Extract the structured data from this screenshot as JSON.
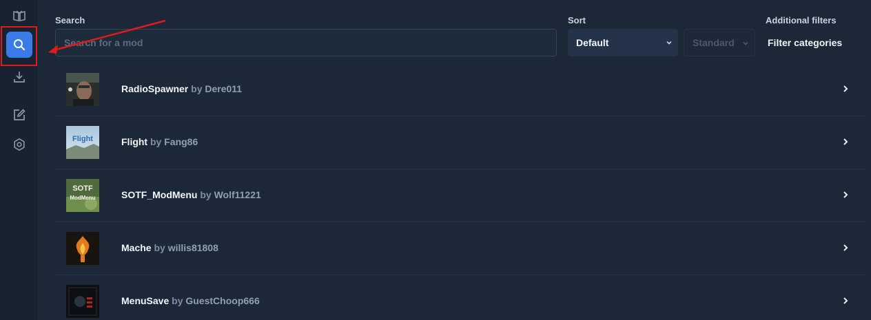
{
  "search": {
    "label": "Search",
    "placeholder": "Search for a mod"
  },
  "sort": {
    "label": "Sort",
    "selected": "Default",
    "secondary": "Standard"
  },
  "filters": {
    "label": "Additional filters",
    "button": "Filter categories"
  },
  "sidebar": {
    "items": [
      {
        "name": "library",
        "icon": "book-icon"
      },
      {
        "name": "search",
        "icon": "search-icon",
        "active": true
      },
      {
        "name": "downloads",
        "icon": "download-icon"
      },
      {
        "name": "edit",
        "icon": "edit-icon"
      },
      {
        "name": "settings",
        "icon": "gear-icon"
      }
    ]
  },
  "mods": [
    {
      "name": "RadioSpawner",
      "by": "by",
      "author": "Dere011"
    },
    {
      "name": "Flight",
      "by": "by",
      "author": "Fang86",
      "thumb_text": "Flight"
    },
    {
      "name": "SOTF_ModMenu",
      "by": "by",
      "author": "Wolf11221",
      "thumb_text": "SOTF",
      "thumb_text2": "ModMenu"
    },
    {
      "name": "Mache",
      "by": "by",
      "author": "willis81808"
    },
    {
      "name": "MenuSave",
      "by": "by",
      "author": "GuestChoop666"
    }
  ],
  "colors": {
    "background": "#1c2838",
    "sidebar": "#182231",
    "accent": "#3b7be8",
    "annotation": "#e01b1b"
  }
}
